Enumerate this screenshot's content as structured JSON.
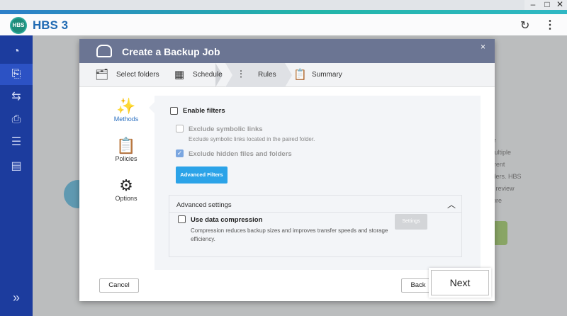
{
  "window": {
    "minimize_glyph": "–",
    "maximize_glyph": "□",
    "close_glyph": "✕"
  },
  "app": {
    "title": "HBS 3",
    "logo_text": "HBS",
    "refresh_glyph": "↻",
    "more_glyph": "⋮"
  },
  "sidebar": {
    "items": [
      {
        "icon": "dashboard-icon",
        "glyph": "◔"
      },
      {
        "icon": "backup-icon",
        "glyph": "⎘",
        "active": true
      },
      {
        "icon": "sync-icon",
        "glyph": "⇆"
      },
      {
        "icon": "restore-icon",
        "glyph": "⎙"
      },
      {
        "icon": "storage-space-icon",
        "glyph": "☰"
      },
      {
        "icon": "logs-icon",
        "glyph": "▤"
      }
    ],
    "expand_glyph": "»"
  },
  "background": {
    "text_lines": [
      "le for",
      "te multiple",
      "different",
      "roviders. HBS",
      "obs, review",
      "restore"
    ]
  },
  "dialog": {
    "title": "Create a Backup Job",
    "close_glyph": "×",
    "steps": [
      {
        "label": "Select folders",
        "icon": "select-folders-icon",
        "glyph": "🗂"
      },
      {
        "label": "Schedule",
        "icon": "calendar-icon",
        "glyph": "▦"
      },
      {
        "label": "Rules",
        "icon": "sliders-icon",
        "glyph": "⫶",
        "active": true
      },
      {
        "label": "Summary",
        "icon": "clipboard-icon",
        "glyph": "📋"
      }
    ],
    "left_nav": [
      {
        "label": "Methods",
        "icon": "magic-wand-icon",
        "glyph": "✨",
        "active": true
      },
      {
        "label": "Policies",
        "icon": "clipboard-check-icon",
        "glyph": "📋"
      },
      {
        "label": "Options",
        "icon": "gear-icon",
        "glyph": "⚙"
      }
    ],
    "filters": {
      "enable_label": "Enable filters",
      "enabled": false,
      "exclude_symlinks_label": "Exclude symbolic links",
      "exclude_symlinks_desc": "Exclude symbolic links located in the paired folder.",
      "exclude_symlinks_checked": false,
      "exclude_hidden_label": "Exclude hidden files and folders",
      "exclude_hidden_checked": true,
      "advanced_filters_button": "Advanced Filters"
    },
    "advanced_settings": {
      "title": "Advanced settings",
      "collapse_glyph": "︿",
      "compression_label": "Use data compression",
      "compression_checked": false,
      "compression_desc": "Compression reduces backup sizes and improves transfer speeds and storage efficiency.",
      "settings_button": "Settings"
    },
    "footer": {
      "cancel": "Cancel",
      "back": "Back",
      "next": "Next"
    }
  },
  "colors": {
    "accent_blue": "#2ba3e8",
    "sidebar_bg": "#1c3c9e",
    "dialog_header": "#6b7593",
    "brand_title": "#1f6ab3"
  }
}
